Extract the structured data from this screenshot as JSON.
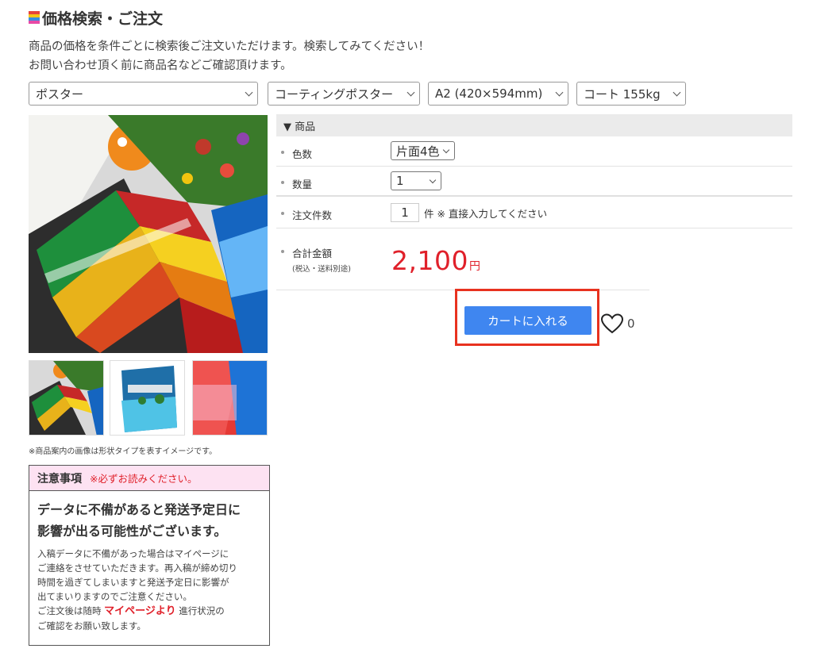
{
  "page": {
    "title": "価格検索・ご注文",
    "intro_line1": "商品の価格を条件ごとに検索後ご注文いただけます。検索してみてください！",
    "intro_line2": "お問い合わせ頂く前に商品名などご確認頂けます。"
  },
  "filters": {
    "category": "ポスター",
    "product": "コーティングポスター",
    "size": "A2 (420×594mm)",
    "paper": "コート 155kg"
  },
  "product_panel": {
    "header": "▼ 商品",
    "color_label": "色数",
    "color_value": "片面4色",
    "quantity_label": "数量",
    "quantity_value": "1",
    "orders_label": "注文件数",
    "orders_value": "1",
    "orders_hint": "件 ※ 直接入力してください",
    "total_label": "合計金額",
    "total_note": "(税込・送料別途)",
    "total_price": "2,100",
    "currency": "円"
  },
  "actions": {
    "cart_button": "カートに入れる",
    "favorite_count": "0"
  },
  "images": {
    "note": "※商品案内の画像は形状タイプを表すイメージです。"
  },
  "caution": {
    "title": "注意事項",
    "subtitle": "※必ずお読みください。",
    "headline_line1": "データに不備があると発送予定日に",
    "headline_line2": "影響が出る可能性がございます。",
    "body_line1": "入稿データに不備があった場合はマイページに",
    "body_line2": "ご連絡をさせていただきます。再入稿が締め切り",
    "body_line3": "時間を過ぎてしまいますと発送予定日に影響が",
    "body_line4": "出てまいりますのでご注意ください。",
    "body_line5_pre": "ご注文後は随時",
    "body_line5_link": "マイページより",
    "body_line5_post": "進行状況の",
    "body_line6": "ご確認をお願い致します。"
  },
  "colors": {
    "accent_blue": "#3f86f0",
    "price_red": "#e0202a",
    "highlight_frame": "#e8321f",
    "caution_header_bg": "#fde2f2"
  }
}
